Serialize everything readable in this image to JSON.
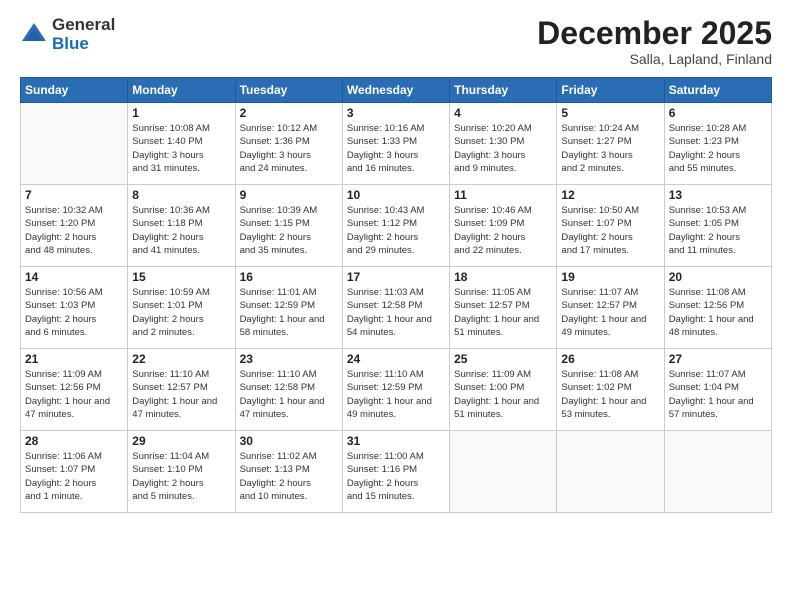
{
  "logo": {
    "general": "General",
    "blue": "Blue"
  },
  "header": {
    "month": "December 2025",
    "location": "Salla, Lapland, Finland"
  },
  "weekdays": [
    "Sunday",
    "Monday",
    "Tuesday",
    "Wednesday",
    "Thursday",
    "Friday",
    "Saturday"
  ],
  "weeks": [
    [
      {
        "day": "",
        "info": ""
      },
      {
        "day": "1",
        "info": "Sunrise: 10:08 AM\nSunset: 1:40 PM\nDaylight: 3 hours\nand 31 minutes."
      },
      {
        "day": "2",
        "info": "Sunrise: 10:12 AM\nSunset: 1:36 PM\nDaylight: 3 hours\nand 24 minutes."
      },
      {
        "day": "3",
        "info": "Sunrise: 10:16 AM\nSunset: 1:33 PM\nDaylight: 3 hours\nand 16 minutes."
      },
      {
        "day": "4",
        "info": "Sunrise: 10:20 AM\nSunset: 1:30 PM\nDaylight: 3 hours\nand 9 minutes."
      },
      {
        "day": "5",
        "info": "Sunrise: 10:24 AM\nSunset: 1:27 PM\nDaylight: 3 hours\nand 2 minutes."
      },
      {
        "day": "6",
        "info": "Sunrise: 10:28 AM\nSunset: 1:23 PM\nDaylight: 2 hours\nand 55 minutes."
      }
    ],
    [
      {
        "day": "7",
        "info": "Sunrise: 10:32 AM\nSunset: 1:20 PM\nDaylight: 2 hours\nand 48 minutes."
      },
      {
        "day": "8",
        "info": "Sunrise: 10:36 AM\nSunset: 1:18 PM\nDaylight: 2 hours\nand 41 minutes."
      },
      {
        "day": "9",
        "info": "Sunrise: 10:39 AM\nSunset: 1:15 PM\nDaylight: 2 hours\nand 35 minutes."
      },
      {
        "day": "10",
        "info": "Sunrise: 10:43 AM\nSunset: 1:12 PM\nDaylight: 2 hours\nand 29 minutes."
      },
      {
        "day": "11",
        "info": "Sunrise: 10:46 AM\nSunset: 1:09 PM\nDaylight: 2 hours\nand 22 minutes."
      },
      {
        "day": "12",
        "info": "Sunrise: 10:50 AM\nSunset: 1:07 PM\nDaylight: 2 hours\nand 17 minutes."
      },
      {
        "day": "13",
        "info": "Sunrise: 10:53 AM\nSunset: 1:05 PM\nDaylight: 2 hours\nand 11 minutes."
      }
    ],
    [
      {
        "day": "14",
        "info": "Sunrise: 10:56 AM\nSunset: 1:03 PM\nDaylight: 2 hours\nand 6 minutes."
      },
      {
        "day": "15",
        "info": "Sunrise: 10:59 AM\nSunset: 1:01 PM\nDaylight: 2 hours\nand 2 minutes."
      },
      {
        "day": "16",
        "info": "Sunrise: 11:01 AM\nSunset: 12:59 PM\nDaylight: 1 hour and\n58 minutes."
      },
      {
        "day": "17",
        "info": "Sunrise: 11:03 AM\nSunset: 12:58 PM\nDaylight: 1 hour and\n54 minutes."
      },
      {
        "day": "18",
        "info": "Sunrise: 11:05 AM\nSunset: 12:57 PM\nDaylight: 1 hour and\n51 minutes."
      },
      {
        "day": "19",
        "info": "Sunrise: 11:07 AM\nSunset: 12:57 PM\nDaylight: 1 hour and\n49 minutes."
      },
      {
        "day": "20",
        "info": "Sunrise: 11:08 AM\nSunset: 12:56 PM\nDaylight: 1 hour and\n48 minutes."
      }
    ],
    [
      {
        "day": "21",
        "info": "Sunrise: 11:09 AM\nSunset: 12:56 PM\nDaylight: 1 hour and\n47 minutes."
      },
      {
        "day": "22",
        "info": "Sunrise: 11:10 AM\nSunset: 12:57 PM\nDaylight: 1 hour and\n47 minutes."
      },
      {
        "day": "23",
        "info": "Sunrise: 11:10 AM\nSunset: 12:58 PM\nDaylight: 1 hour and\n47 minutes."
      },
      {
        "day": "24",
        "info": "Sunrise: 11:10 AM\nSunset: 12:59 PM\nDaylight: 1 hour and\n49 minutes."
      },
      {
        "day": "25",
        "info": "Sunrise: 11:09 AM\nSunset: 1:00 PM\nDaylight: 1 hour and\n51 minutes."
      },
      {
        "day": "26",
        "info": "Sunrise: 11:08 AM\nSunset: 1:02 PM\nDaylight: 1 hour and\n53 minutes."
      },
      {
        "day": "27",
        "info": "Sunrise: 11:07 AM\nSunset: 1:04 PM\nDaylight: 1 hour and\n57 minutes."
      }
    ],
    [
      {
        "day": "28",
        "info": "Sunrise: 11:06 AM\nSunset: 1:07 PM\nDaylight: 2 hours\nand 1 minute."
      },
      {
        "day": "29",
        "info": "Sunrise: 11:04 AM\nSunset: 1:10 PM\nDaylight: 2 hours\nand 5 minutes."
      },
      {
        "day": "30",
        "info": "Sunrise: 11:02 AM\nSunset: 1:13 PM\nDaylight: 2 hours\nand 10 minutes."
      },
      {
        "day": "31",
        "info": "Sunrise: 11:00 AM\nSunset: 1:16 PM\nDaylight: 2 hours\nand 15 minutes."
      },
      {
        "day": "",
        "info": ""
      },
      {
        "day": "",
        "info": ""
      },
      {
        "day": "",
        "info": ""
      }
    ]
  ]
}
